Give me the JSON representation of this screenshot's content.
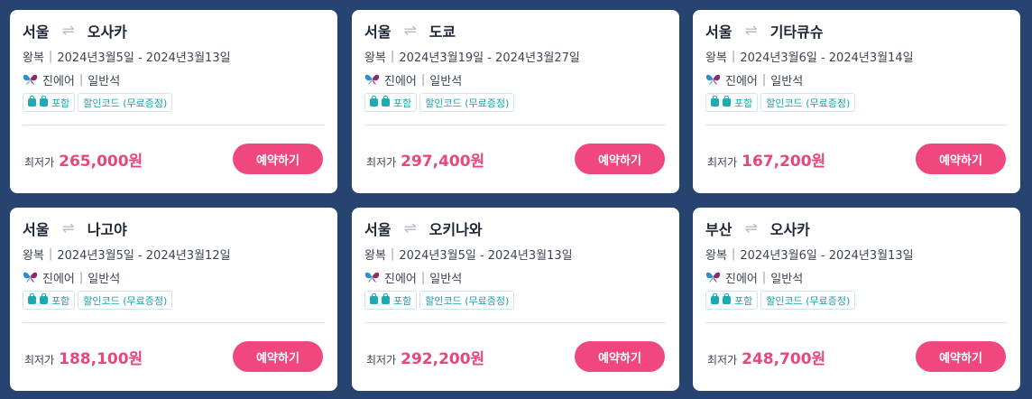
{
  "cards": [
    {
      "from": "서울",
      "to": "오사카",
      "trip": "왕복",
      "dates": "2024년3월5일 - 2024년3월13일",
      "airline": "진에어",
      "seat": "일반석",
      "tag1": "포함",
      "tag2": "할인코드 (무료증정)",
      "price_label": "최저가",
      "price": "265,000원",
      "book": "예약하기"
    },
    {
      "from": "서울",
      "to": "도쿄",
      "trip": "왕복",
      "dates": "2024년3월19일 - 2024년3월27일",
      "airline": "진에어",
      "seat": "일반석",
      "tag1": "포함",
      "tag2": "할인코드 (무료증정)",
      "price_label": "최저가",
      "price": "297,400원",
      "book": "예약하기"
    },
    {
      "from": "서울",
      "to": "기타큐슈",
      "trip": "왕복",
      "dates": "2024년3월6일 - 2024년3월14일",
      "airline": "진에어",
      "seat": "일반석",
      "tag1": "포함",
      "tag2": "할인코드 (무료증정)",
      "price_label": "최저가",
      "price": "167,200원",
      "book": "예약하기"
    },
    {
      "from": "서울",
      "to": "나고야",
      "trip": "왕복",
      "dates": "2024년3월5일 - 2024년3월12일",
      "airline": "진에어",
      "seat": "일반석",
      "tag1": "포함",
      "tag2": "할인코드 (무료증정)",
      "price_label": "최저가",
      "price": "188,100원",
      "book": "예약하기"
    },
    {
      "from": "서울",
      "to": "오키나와",
      "trip": "왕복",
      "dates": "2024년3월5일 - 2024년3월13일",
      "airline": "진에어",
      "seat": "일반석",
      "tag1": "포함",
      "tag2": "할인코드 (무료증정)",
      "price_label": "최저가",
      "price": "292,200원",
      "book": "예약하기"
    },
    {
      "from": "부산",
      "to": "오사카",
      "trip": "왕복",
      "dates": "2024년3월6일 - 2024년3월13일",
      "airline": "진에어",
      "seat": "일반석",
      "tag1": "포함",
      "tag2": "할인코드 (무료증정)",
      "price_label": "최저가",
      "price": "248,700원",
      "book": "예약하기"
    }
  ],
  "icons": {
    "swap": "swap-arrows-icon",
    "airline_logo": "jinair-butterfly-icon",
    "bag": "baggage-icon"
  },
  "colors": {
    "background": "#26446f",
    "accent": "#f0487e",
    "price": "#e8467c",
    "tag": "#1b9fab"
  }
}
